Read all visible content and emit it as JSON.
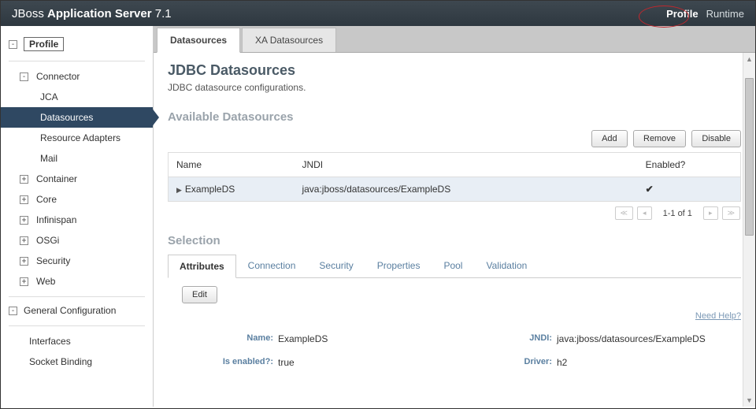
{
  "header": {
    "brand_prefix": "JBoss ",
    "brand_bold": "Application Server",
    "brand_version": " 7.1",
    "nav": {
      "profile": "Profile",
      "runtime": "Runtime"
    }
  },
  "sidebar": {
    "root": "Profile",
    "connector": {
      "label": "Connector",
      "children": {
        "jca": "JCA",
        "datasources": "Datasources",
        "resource_adapters": "Resource Adapters",
        "mail": "Mail"
      }
    },
    "container": "Container",
    "core": "Core",
    "infinispan": "Infinispan",
    "osgi": "OSGi",
    "security": "Security",
    "web": "Web",
    "general_config": {
      "label": "General Configuration",
      "children": {
        "interfaces": "Interfaces",
        "socket_binding": "Socket Binding"
      }
    }
  },
  "tabs": {
    "datasources": "Datasources",
    "xa": "XA Datasources"
  },
  "main": {
    "title": "JDBC Datasources",
    "subtitle": "JDBC datasource configurations.",
    "available": "Available Datasources",
    "buttons": {
      "add": "Add",
      "remove": "Remove",
      "disable": "Disable"
    },
    "columns": {
      "name": "Name",
      "jndi": "JNDI",
      "enabled": "Enabled?"
    },
    "rows": [
      {
        "name": "ExampleDS",
        "jndi": "java:jboss/datasources/ExampleDS",
        "enabled": true
      }
    ],
    "paginator": "1-1 of 1",
    "selection": "Selection",
    "subtabs": {
      "attributes": "Attributes",
      "connection": "Connection",
      "security": "Security",
      "properties": "Properties",
      "pool": "Pool",
      "validation": "Validation"
    },
    "edit": "Edit",
    "help": "Need Help?",
    "form": {
      "name": {
        "label": "Name:",
        "value": "ExampleDS"
      },
      "jndi": {
        "label": "JNDI:",
        "value": "java:jboss/datasources/ExampleDS"
      },
      "enabled": {
        "label": "Is enabled?:",
        "value": "true"
      },
      "driver": {
        "label": "Driver:",
        "value": "h2"
      }
    }
  }
}
